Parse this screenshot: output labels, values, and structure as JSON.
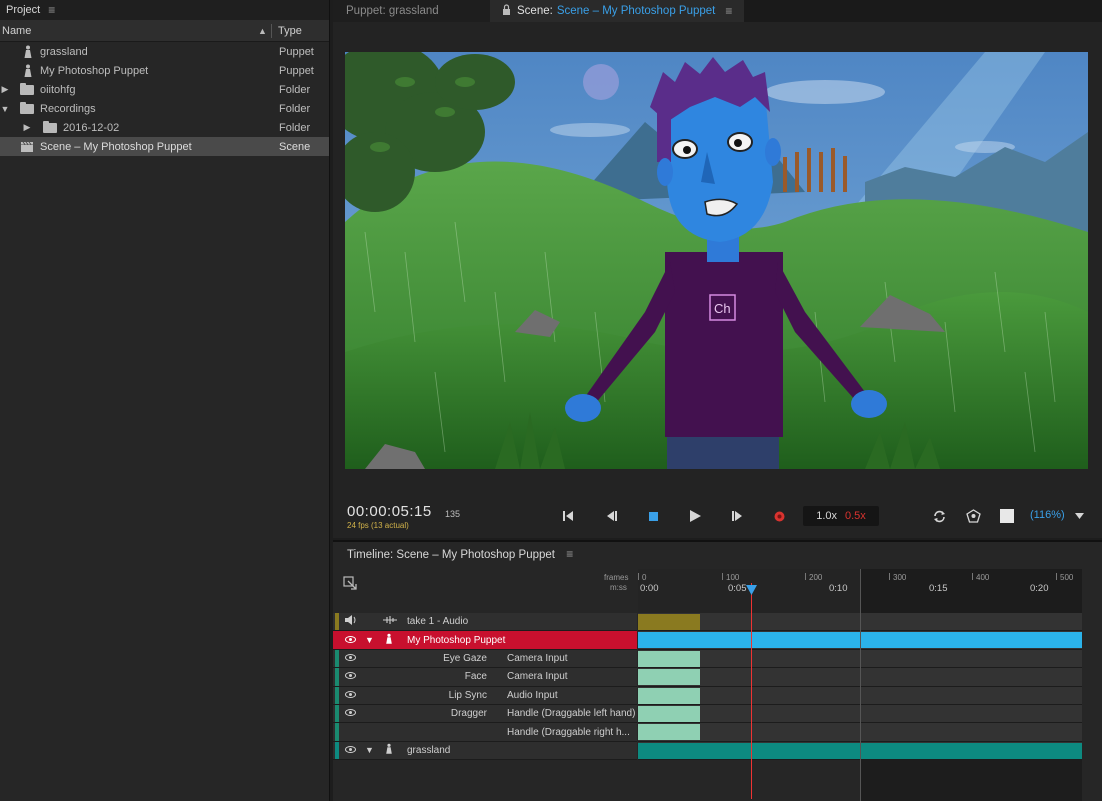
{
  "project": {
    "tab_label": "Project",
    "columns": {
      "name": "Name",
      "type": "Type"
    },
    "items": [
      {
        "name": "grassland",
        "type": "Puppet",
        "kind": "puppet",
        "indent": 0,
        "twirl": ""
      },
      {
        "name": "My Photoshop Puppet",
        "type": "Puppet",
        "kind": "puppet",
        "indent": 0,
        "twirl": ""
      },
      {
        "name": "oiitohfg",
        "type": "Folder",
        "kind": "folder",
        "indent": 0,
        "twirl": "▶"
      },
      {
        "name": "Recordings",
        "type": "Folder",
        "kind": "folder",
        "indent": 0,
        "twirl": "▼"
      },
      {
        "name": "2016-12-02",
        "type": "Folder",
        "kind": "folder",
        "indent": 1,
        "twirl": "▶"
      },
      {
        "name": "Scene – My Photoshop Puppet",
        "type": "Scene",
        "kind": "scene",
        "indent": 0,
        "twirl": "",
        "selected": true
      }
    ]
  },
  "scene_panel": {
    "tab_puppet": "Puppet: grassland",
    "tab_scene_label": "Scene:",
    "tab_scene_value": "Scene – My Photoshop Puppet",
    "stage_badge": "Ch",
    "timecode": "00:00:05:15",
    "frame_number": "135",
    "fps": "24 fps (13 actual)",
    "rate": "1.0x",
    "rate_alt": "0.5x",
    "zoom": "(116%)"
  },
  "timeline": {
    "title": "Timeline: Scene – My Photoshop Puppet",
    "ruler": {
      "frames_label": "frames",
      "mss_label": "m:ss",
      "frame_ticks": [
        "0",
        "100",
        "200",
        "300",
        "400",
        "500"
      ],
      "time_ticks": [
        "0:00",
        "0:05",
        "0:10",
        "0:15",
        "0:20"
      ]
    },
    "tracks": [
      {
        "id": "audio",
        "label": "take 1 - Audio"
      },
      {
        "id": "puppet",
        "label": "My Photoshop Puppet"
      },
      {
        "id": "eye-gaze",
        "behavior": "Eye Gaze",
        "source": "Camera Input"
      },
      {
        "id": "face",
        "behavior": "Face",
        "source": "Camera Input"
      },
      {
        "id": "lip-sync",
        "behavior": "Lip Sync",
        "source": "Audio Input"
      },
      {
        "id": "dragger",
        "behavior": "Dragger",
        "source": "Handle (Draggable left hand)"
      },
      {
        "id": "dragger-2",
        "behavior": "",
        "source": "Handle (Draggable right h..."
      },
      {
        "id": "grassland",
        "label": "grassland"
      }
    ]
  },
  "colors": {
    "accent_blue": "#3aa0e8",
    "record_red": "#d9332f",
    "puppet_track_red": "#c8102e",
    "behavior_clip": "#8fd0b3",
    "audio_clip": "#8a7a20",
    "teal_clip": "#0d8a80",
    "scene_clip": "#2bb3ea"
  }
}
